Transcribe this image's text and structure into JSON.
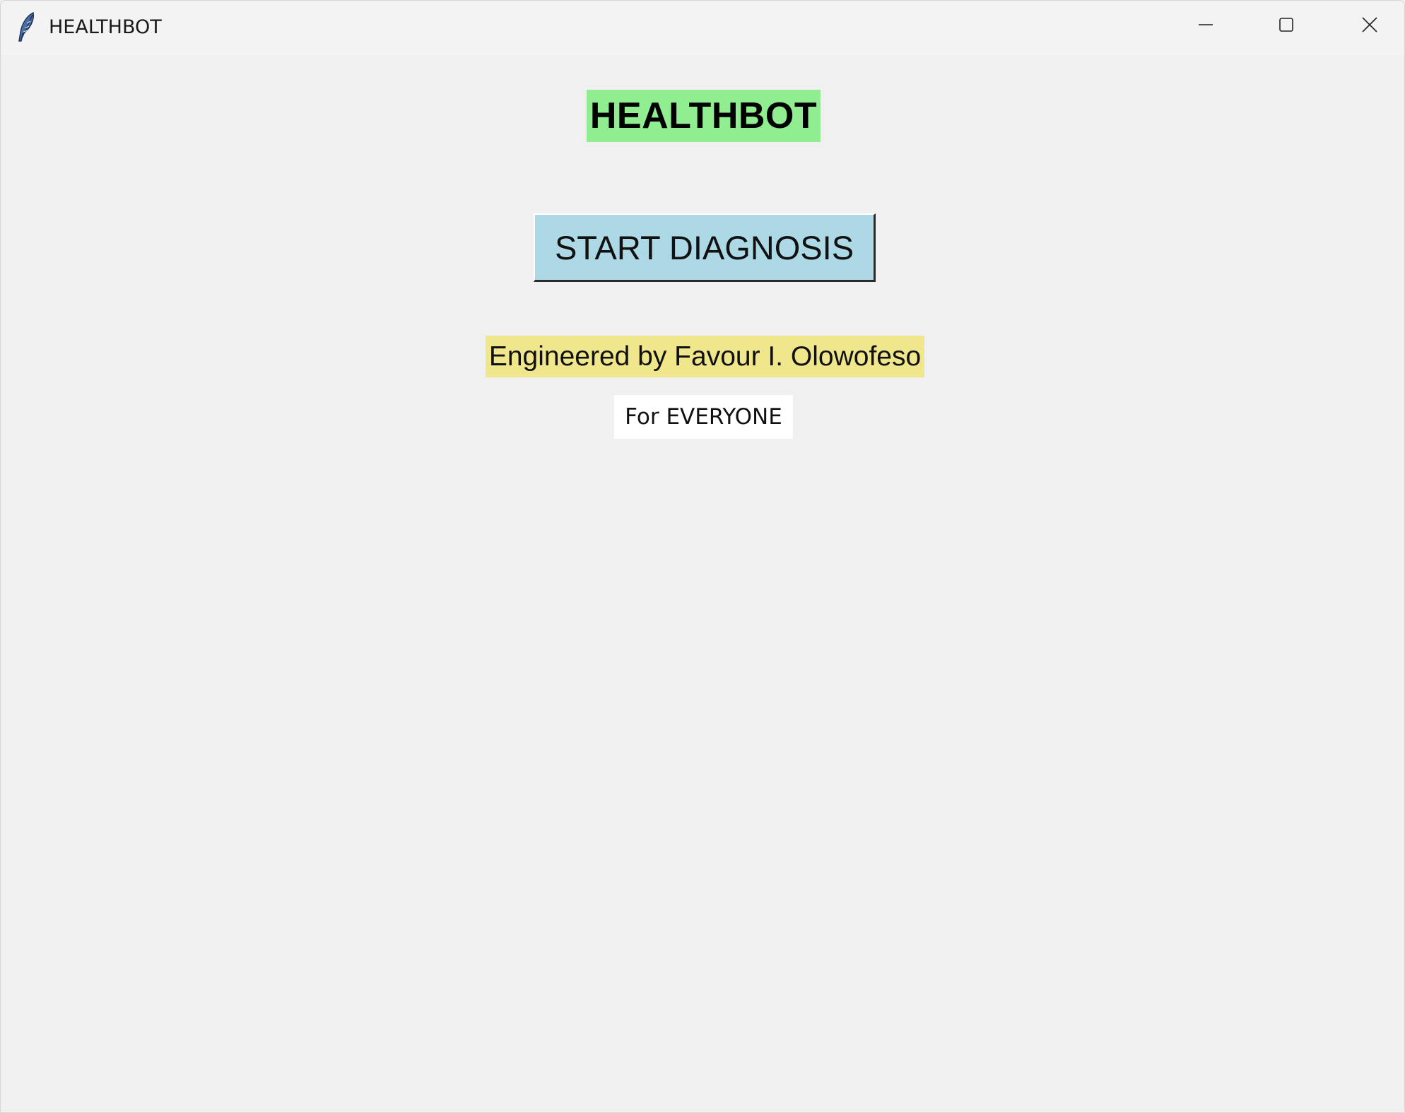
{
  "window": {
    "title": "HEALTHBOT",
    "icon": "feather-icon",
    "controls": {
      "minimize": "minimize-icon",
      "maximize": "maximize-icon",
      "close": "close-icon"
    }
  },
  "main": {
    "heading": "HEALTHBOT",
    "start_button_label": "START DIAGNOSIS",
    "credit": "Engineered by Favour I. Olowofeso",
    "audience": "For EVERYONE"
  },
  "colors": {
    "heading_bg": "#90ee90",
    "button_bg": "#add8e6",
    "credit_bg": "#f0e68c",
    "audience_bg": "#ffffff",
    "window_bg": "#f0f0f0"
  }
}
